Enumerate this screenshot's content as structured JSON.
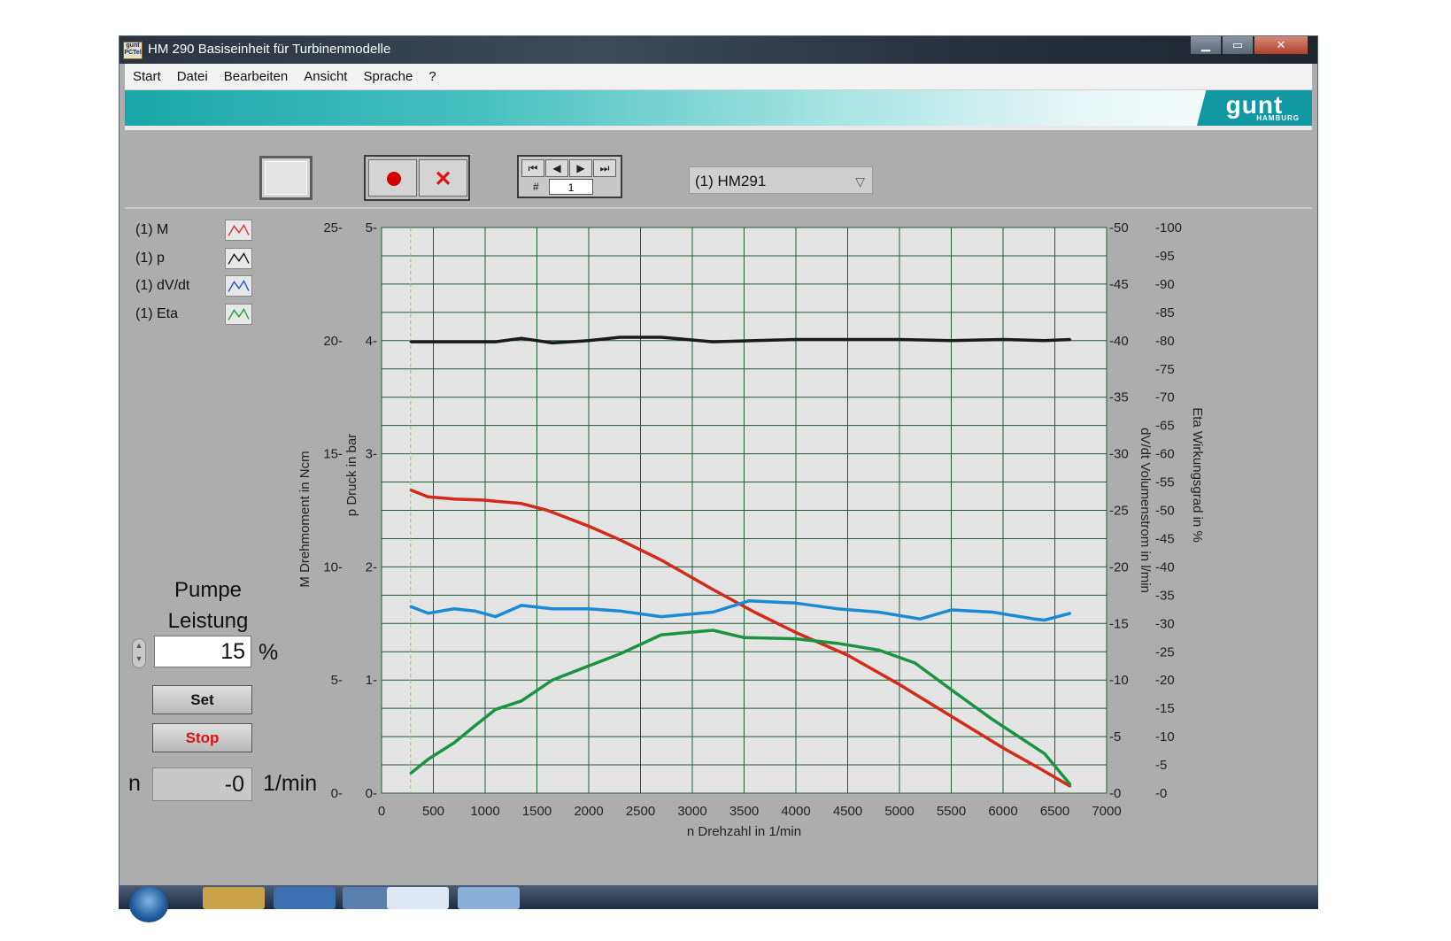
{
  "window": {
    "title": "HM 290 Basiseinheit für Turbinenmodelle",
    "app_icon_text": "gunt PCTel",
    "controls": [
      "minimize-icon",
      "maximize-icon",
      "close-icon"
    ]
  },
  "menu": [
    "Start",
    "Datei",
    "Bearbeiten",
    "Ansicht",
    "Sprache",
    "?"
  ],
  "brand": {
    "logo_text": "gunt",
    "logo_sub": "HAMBURG",
    "banner_color": "#1aa7a7"
  },
  "toolbar": {
    "record_icon": "record-icon",
    "delete_icon": "delete-x-icon",
    "nav_icons": [
      "first-record-icon",
      "previous-record-icon",
      "next-record-icon",
      "last-record-icon"
    ],
    "record_label": "#",
    "record_number": "1",
    "device_select": "(1) HM291"
  },
  "legend": [
    {
      "label": "(1) M",
      "color": "#e03020"
    },
    {
      "label": "(1) p",
      "color": "#111111"
    },
    {
      "label": "(1) dV/dt",
      "color": "#1a50e0"
    },
    {
      "label": "(1) Eta",
      "color": "#18a030"
    }
  ],
  "pump": {
    "title_line1": "Pumpe",
    "title_line2": "Leistung",
    "value": "15",
    "unit": "%",
    "set_label": "Set",
    "stop_label": "Stop",
    "speed_label": "n",
    "speed_value": "-0",
    "speed_unit": "1/min"
  },
  "chart_data": {
    "type": "line",
    "xlabel": "n Drehzahl  in 1/min",
    "xlim": [
      0,
      7000
    ],
    "x_ticks": [
      "0",
      "500",
      "1000",
      "1500",
      "2000",
      "2500",
      "3000",
      "3500",
      "4000",
      "4500",
      "5000",
      "5500",
      "6000",
      "6500",
      "7000"
    ],
    "cursor_x": 280,
    "grid": true,
    "axes": {
      "M": {
        "label": "M Drehmoment  in Ncm",
        "ylim": [
          0,
          25
        ],
        "ticks": [
          "0-",
          "5-",
          "10-",
          "15-",
          "20-",
          "25-"
        ]
      },
      "p": {
        "label": "p Druck  in bar",
        "ylim": [
          0,
          5
        ],
        "ticks": [
          "0-",
          "1-",
          "2-",
          "3-",
          "4-",
          "5-"
        ]
      },
      "dVdt": {
        "label": "dV/dt Volumenstrom  in l/min",
        "ylim": [
          0,
          50
        ],
        "ticks": [
          "-0",
          "-5",
          "-10",
          "-15",
          "-20",
          "-25",
          "-30",
          "-35",
          "-40",
          "-45",
          "-50"
        ]
      },
      "Eta": {
        "label": "Eta Wirkungsgrad in %",
        "ylim": [
          0,
          100
        ],
        "ticks": [
          "-0",
          "-5",
          "-10",
          "-15",
          "-20",
          "-25",
          "-30",
          "-35",
          "-40",
          "-45",
          "-50",
          "-55",
          "-60",
          "-65",
          "-70",
          "-75",
          "-80",
          "-85",
          "-90",
          "-95",
          "-100"
        ]
      }
    },
    "series": [
      {
        "name": "(1) M",
        "axis": "M",
        "color": "#d42a1a",
        "x": [
          280,
          450,
          700,
          1000,
          1100,
          1350,
          1600,
          2000,
          2300,
          2700,
          3200,
          3600,
          4000,
          4500,
          5000,
          5500,
          6000,
          6350,
          6650
        ],
        "values": [
          13.4,
          13.1,
          13.0,
          12.95,
          12.9,
          12.8,
          12.5,
          11.8,
          11.2,
          10.3,
          9.0,
          8.0,
          7.1,
          6.1,
          4.8,
          3.4,
          2.0,
          1.1,
          0.3
        ]
      },
      {
        "name": "(1) p",
        "axis": "p",
        "color": "#1a1a1a",
        "x": [
          280,
          700,
          1000,
          1100,
          1350,
          1650,
          2000,
          2300,
          2700,
          3200,
          3600,
          4000,
          4500,
          5000,
          5500,
          6000,
          6400,
          6650
        ],
        "values": [
          3.99,
          3.99,
          3.99,
          3.99,
          4.02,
          3.98,
          4.0,
          4.03,
          4.03,
          3.99,
          4.0,
          4.01,
          4.01,
          4.01,
          4.0,
          4.01,
          4.0,
          4.01
        ]
      },
      {
        "name": "(1) dV/dt",
        "axis": "dVdt",
        "color": "#1a8ad4",
        "x": [
          280,
          450,
          700,
          900,
          1100,
          1350,
          1650,
          2000,
          2300,
          2700,
          3200,
          3550,
          4000,
          4400,
          4800,
          5200,
          5500,
          5900,
          6300,
          6400,
          6650
        ],
        "values": [
          16.5,
          15.9,
          16.3,
          16.1,
          15.6,
          16.6,
          16.3,
          16.3,
          16.1,
          15.6,
          16.0,
          17.0,
          16.8,
          16.3,
          16.0,
          15.4,
          16.2,
          16.0,
          15.4,
          15.3,
          15.9
        ]
      },
      {
        "name": "(1) Eta",
        "axis": "Eta",
        "color": "#1a9440",
        "x": [
          280,
          450,
          700,
          900,
          1100,
          1350,
          1650,
          2000,
          2300,
          2700,
          3200,
          3500,
          4000,
          4400,
          4800,
          5150,
          5500,
          5900,
          6400,
          6650
        ],
        "values": [
          3.5,
          6.0,
          8.9,
          11.9,
          14.8,
          16.3,
          20.0,
          22.5,
          24.6,
          28.0,
          28.8,
          27.5,
          27.3,
          26.5,
          25.3,
          23.0,
          18.3,
          13.0,
          7.0,
          1.5
        ]
      }
    ]
  }
}
